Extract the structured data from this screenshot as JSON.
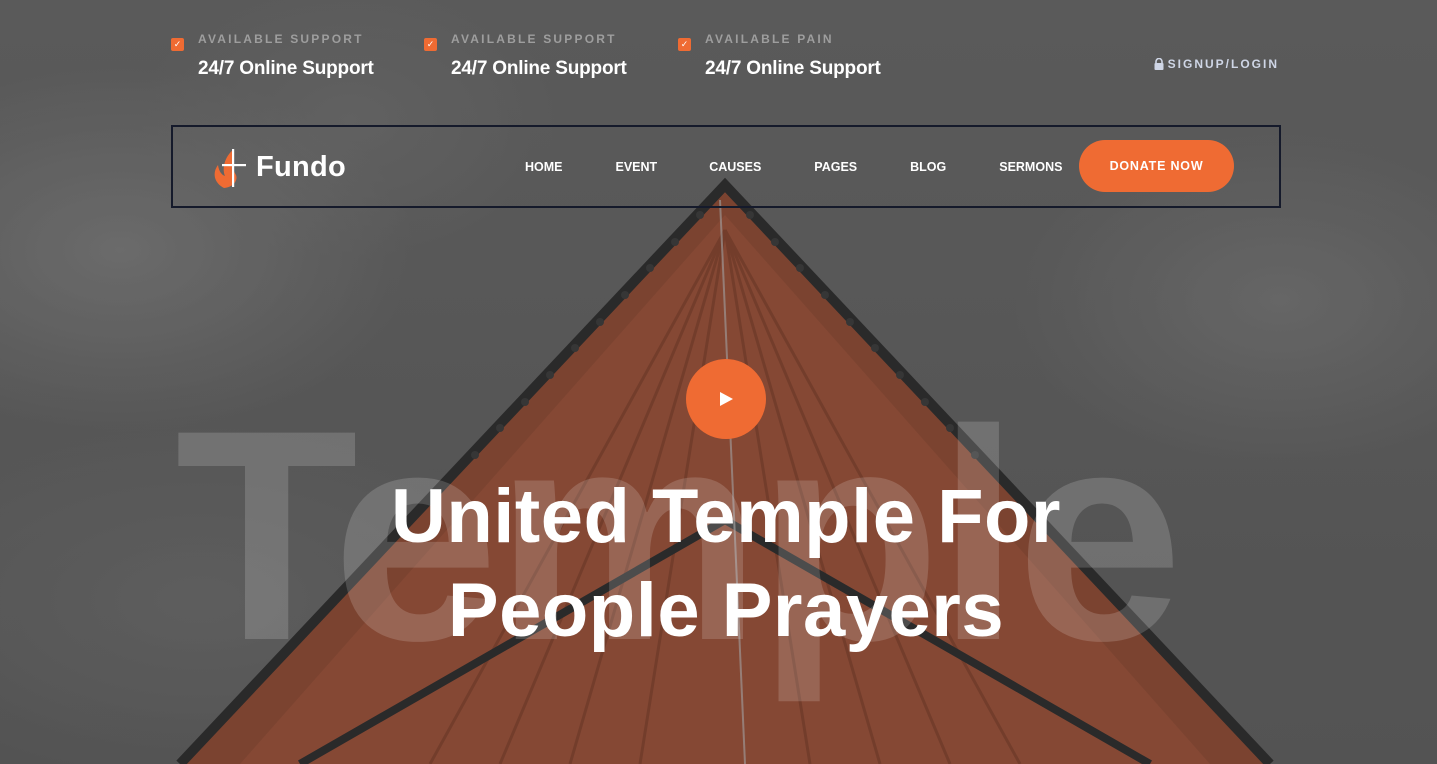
{
  "top_bar": {
    "items": [
      {
        "label": "AVAILABLE SUPPORT",
        "value": "24/7 Online Support"
      },
      {
        "label": "AVAILABLE SUPPORT",
        "value": "24/7 Online Support"
      },
      {
        "label": "AVAILABLE PAIN",
        "value": "24/7 Online Support"
      }
    ],
    "login_label": "SIGNUP/LOGIN"
  },
  "navbar": {
    "brand": "Fundo",
    "menu": [
      "HOME",
      "EVENT",
      "CAUSES",
      "PAGES",
      "BLOG",
      "SERMONS"
    ],
    "donate_label": "DONATE NOW"
  },
  "hero": {
    "watermark": "Temple",
    "title_line1": "United Temple For",
    "title_line2": "People Prayers"
  },
  "colors": {
    "accent": "#ef6b33",
    "nav_border": "#151a2b",
    "login_text": "#cfd6e6"
  },
  "icons": {
    "check": "checkbox-check-icon",
    "lock": "lock-icon",
    "logo": "flame-cross-logo",
    "play": "play-icon"
  }
}
